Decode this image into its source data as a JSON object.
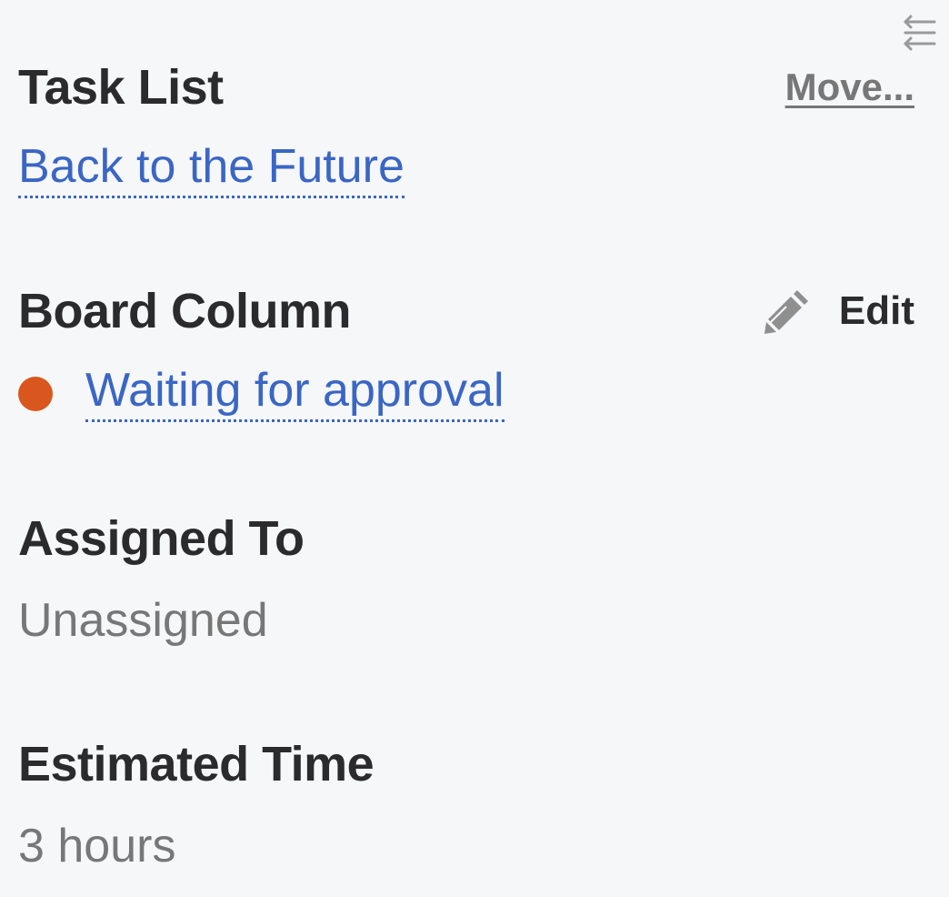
{
  "task_list": {
    "heading": "Task List",
    "move_label": "Move...",
    "value": "Back to the Future"
  },
  "board_column": {
    "heading": "Board Column",
    "edit_label": "Edit",
    "value": "Waiting for approval",
    "status_color": "#d9571f"
  },
  "assigned_to": {
    "heading": "Assigned To",
    "value": "Unassigned"
  },
  "estimated_time": {
    "heading": "Estimated Time",
    "value": "3 hours"
  },
  "colors": {
    "background": "#f6f7f9",
    "heading": "#2b2b2d",
    "link": "#3a66c4",
    "muted": "#777777"
  },
  "icons": {
    "collapse": "collapse-arrows-icon",
    "edit": "pencil-icon"
  }
}
